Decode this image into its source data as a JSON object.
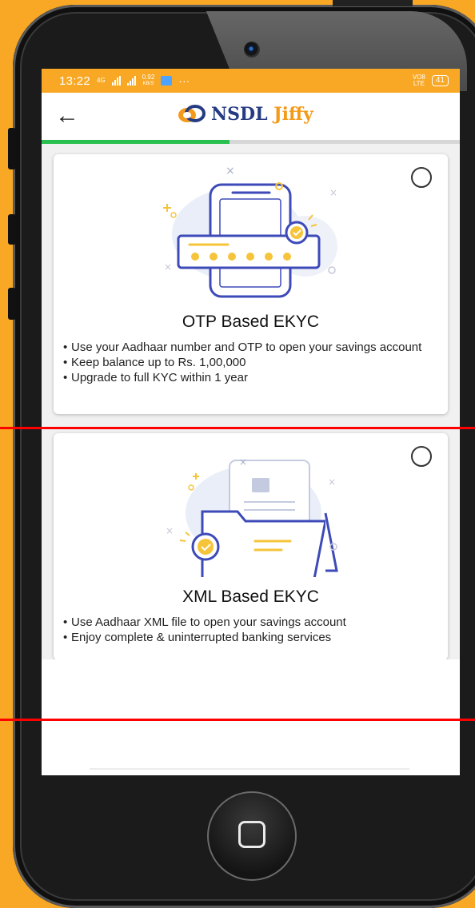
{
  "status_bar": {
    "time": "13:22",
    "net_gen": "4G",
    "speed_value": "0.92",
    "speed_unit": "KB/S",
    "more": "···",
    "volte": "VO8",
    "lte": "LTE",
    "battery": "41"
  },
  "app_bar": {
    "back_glyph": "←",
    "logo_text_main": "NSDL",
    "logo_text_accent": "Jiffy"
  },
  "progress": {
    "value": 0.45
  },
  "options": [
    {
      "title": "OTP Based EKYC",
      "bullets": [
        "Use your Aadhaar number and OTP to open your savings account",
        "Keep balance up to Rs. 1,00,000",
        "Upgrade to full KYC within 1 year"
      ],
      "selected": false,
      "illustration": "phone-otp-illustration"
    },
    {
      "title": "XML Based EKYC",
      "bullets": [
        "Use Aadhaar XML file to open your savings account",
        "Enjoy complete & uninterrupted banking services"
      ],
      "selected": false,
      "illustration": "folder-document-illustration"
    }
  ],
  "colors": {
    "frame_bg": "#f8a825",
    "status_bar": "#f8a825",
    "progress_fill": "#2ac04f",
    "logo_blue": "#263b83",
    "logo_orange": "#f49a1a",
    "illus_blue": "#3d4ab8",
    "illus_yellow": "#f6c43a",
    "annotation_line": "#ff0000"
  },
  "icons": {
    "back": "arrow-left-icon",
    "radio": "radio-unchecked-icon",
    "home": "home-square-icon"
  }
}
